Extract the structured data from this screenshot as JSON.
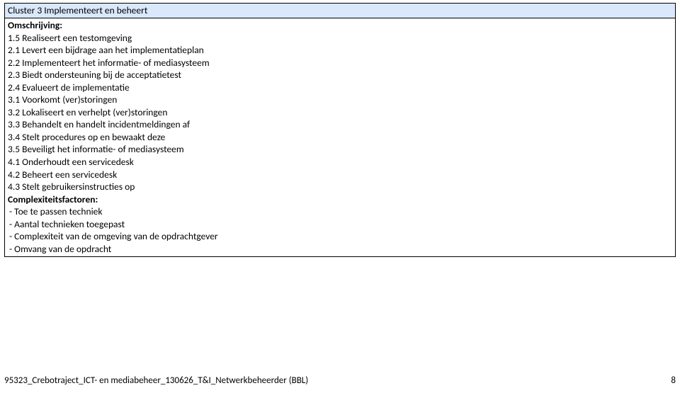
{
  "header": "Cluster 3 Implementeert en beheert",
  "sections": {
    "omschrijving_label": "Omschrijving:",
    "omschrijving_items": [
      "1.5 Realiseert een testomgeving",
      "2.1 Levert een bijdrage aan het implementatieplan",
      "2.2 Implementeert het informatie- of mediasysteem",
      "2.3 Biedt ondersteuning bij de acceptatietest",
      "2.4 Evalueert de implementatie",
      "3.1 Voorkomt (ver)storingen",
      "3.2 Lokaliseert en verhelpt (ver)storingen",
      "3.3 Behandelt en handelt incidentmeldingen af",
      "3.4 Stelt procedures op en bewaakt deze",
      "3.5 Beveiligt het informatie- of mediasysteem",
      "4.1 Onderhoudt een servicedesk",
      "4.2 Beheert een servicedesk",
      "4.3 Stelt gebruikersinstructies op"
    ],
    "complexiteits_label": "Complexiteitsfactoren:",
    "complexiteits_items": [
      "-  Toe te passen techniek",
      "-  Aantal technieken toegepast",
      "-  Complexiteit van de omgeving van de opdrachtgever",
      "-  Omvang van de opdracht"
    ]
  },
  "footer_text": "95323_Crebotraject_ICT- en mediabeheer_130626_T&I_Netwerkbeheerder (BBL)",
  "page_number": "8"
}
